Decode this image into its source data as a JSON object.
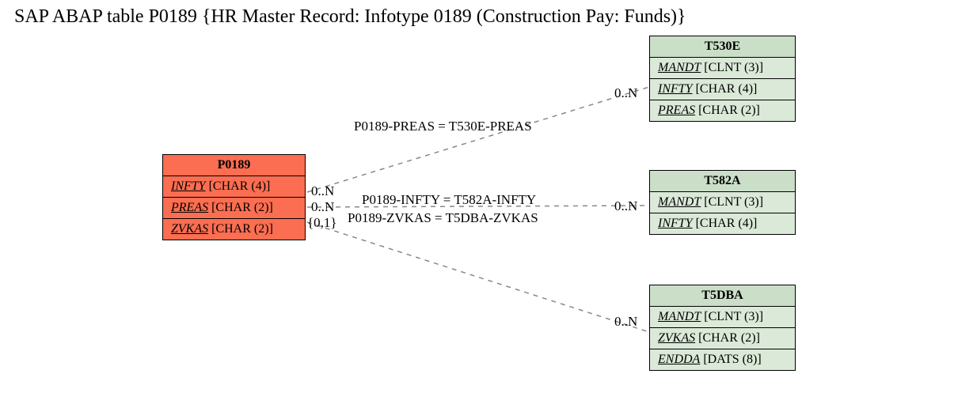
{
  "title": "SAP ABAP table P0189 {HR Master Record: Infotype 0189 (Construction Pay: Funds)}",
  "entities": {
    "P0189": {
      "name": "P0189",
      "fields": [
        {
          "field": "INFTY",
          "type": "[CHAR (4)]"
        },
        {
          "field": "PREAS",
          "type": "[CHAR (2)]"
        },
        {
          "field": "ZVKAS",
          "type": "[CHAR (2)]"
        }
      ]
    },
    "T530E": {
      "name": "T530E",
      "fields": [
        {
          "field": "MANDT",
          "type": "[CLNT (3)]"
        },
        {
          "field": "INFTY",
          "type": "[CHAR (4)]"
        },
        {
          "field": "PREAS",
          "type": "[CHAR (2)]"
        }
      ]
    },
    "T582A": {
      "name": "T582A",
      "fields": [
        {
          "field": "MANDT",
          "type": "[CLNT (3)]"
        },
        {
          "field": "INFTY",
          "type": "[CHAR (4)]"
        }
      ]
    },
    "T5DBA": {
      "name": "T5DBA",
      "fields": [
        {
          "field": "MANDT",
          "type": "[CLNT (3)]"
        },
        {
          "field": "ZVKAS",
          "type": "[CHAR (2)]"
        },
        {
          "field": "ENDDA",
          "type": "[DATS (8)]"
        }
      ]
    }
  },
  "relations": [
    {
      "label": "P0189-PREAS = T530E-PREAS",
      "left_card": "0..N",
      "right_card": "0..N"
    },
    {
      "label": "P0189-INFTY = T582A-INFTY",
      "left_card": "0..N",
      "right_card": "0..N"
    },
    {
      "label": "P0189-ZVKAS = T5DBA-ZVKAS",
      "left_card": "{0,1}",
      "right_card": "0..N"
    }
  ]
}
